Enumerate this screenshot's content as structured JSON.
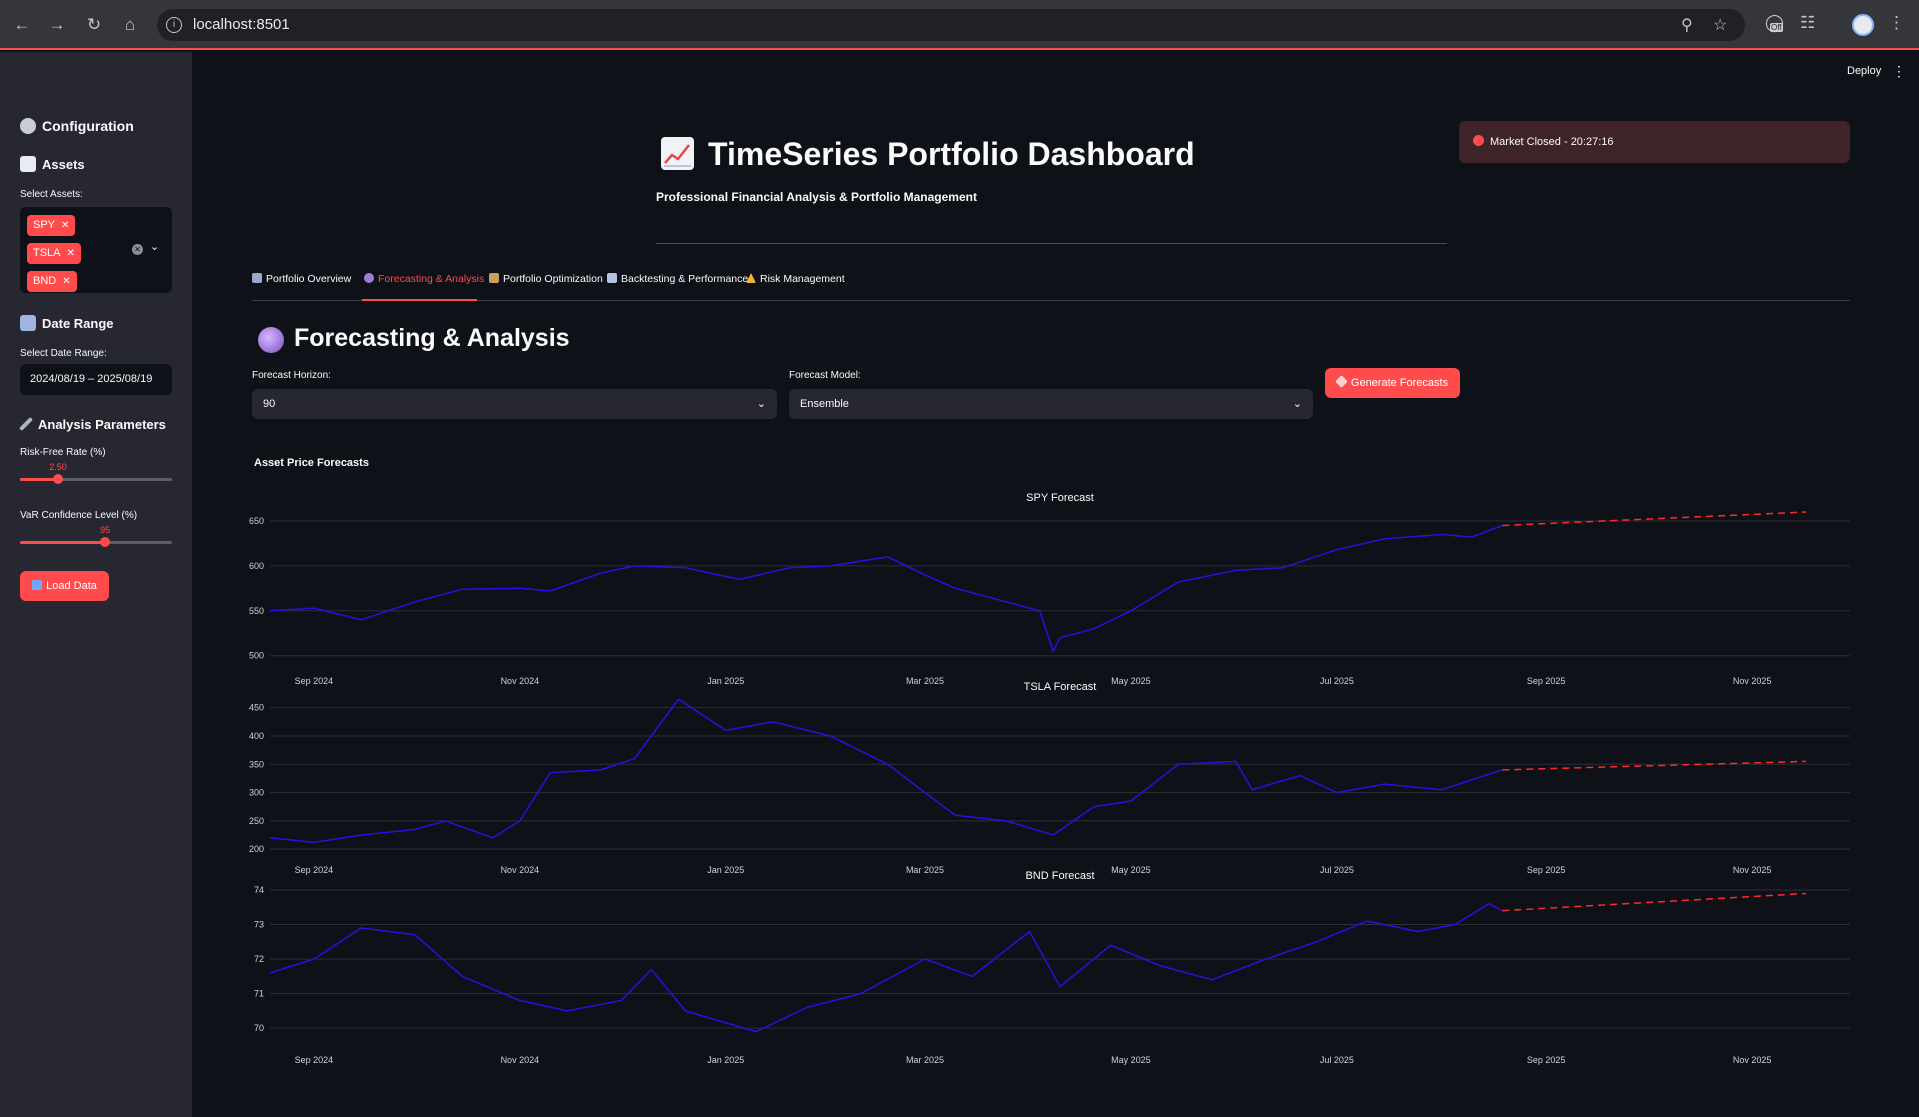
{
  "browser": {
    "url": "localhost:8501",
    "ext_badge": "Off"
  },
  "sidebar": {
    "config_title": "Configuration",
    "assets_title": "Assets",
    "select_assets_label": "Select Assets:",
    "selected_assets": [
      "SPY",
      "TSLA",
      "BND"
    ],
    "date_range_title": "Date Range",
    "date_range_label": "Select Date Range:",
    "date_range_value": "2024/08/19 – 2025/08/19",
    "analysis_title": "Analysis Parameters",
    "risk_free_label": "Risk-Free Rate (%)",
    "risk_free_value": "2.50",
    "risk_free_fraction": 0.25,
    "var_label": "VaR Confidence Level (%)",
    "var_value": "95",
    "var_fraction": 0.56,
    "load_button": "Load Data"
  },
  "header": {
    "deploy": "Deploy",
    "title": "TimeSeries Portfolio Dashboard",
    "subtitle": "Professional Financial Analysis & Portfolio Management",
    "market_status": "Market Closed - 20:27:16"
  },
  "tabs": [
    {
      "label": "Portfolio Overview",
      "icon": "bar-chart-icon",
      "active": false
    },
    {
      "label": "Forecasting & Analysis",
      "icon": "crystal-ball-icon",
      "active": true
    },
    {
      "label": "Portfolio Optimization",
      "icon": "scales-icon",
      "active": false
    },
    {
      "label": "Backtesting & Performance",
      "icon": "chart-up-icon",
      "active": false
    },
    {
      "label": "Risk Management",
      "icon": "warning-icon",
      "active": false
    }
  ],
  "forecast": {
    "section_title": "Forecasting & Analysis",
    "horizon_label": "Forecast Horizon:",
    "horizon_value": "90",
    "model_label": "Forecast Model:",
    "model_value": "Ensemble",
    "generate_button": "Generate Forecasts",
    "charts_heading": "Asset Price Forecasts"
  },
  "colors": {
    "accent": "#ff4b4b",
    "history_line": "#2a10e0",
    "forecast_line": "#ff2b2b",
    "background": "#0e1117",
    "sidebar": "#262730"
  },
  "chart_data": [
    {
      "type": "line",
      "title": "SPY Forecast",
      "x_ticks": [
        "Sep 2024",
        "Nov 2024",
        "Jan 2025",
        "Mar 2025",
        "May 2025",
        "Jul 2025",
        "Sep 2025",
        "Nov 2025"
      ],
      "y_ticks": [
        500,
        550,
        600,
        650
      ],
      "ylim": [
        493,
        660
      ],
      "series": [
        {
          "style": "solid",
          "x": [
            "2024-08-19",
            "2024-09-01",
            "2024-09-15",
            "2024-10-01",
            "2024-10-15",
            "2024-11-01",
            "2024-11-10",
            "2024-11-25",
            "2024-12-05",
            "2024-12-20",
            "2025-01-05",
            "2025-01-20",
            "2025-02-01",
            "2025-02-18",
            "2025-03-01",
            "2025-03-10",
            "2025-03-25",
            "2025-04-04",
            "2025-04-08",
            "2025-04-10",
            "2025-04-20",
            "2025-05-01",
            "2025-05-15",
            "2025-06-01",
            "2025-06-15",
            "2025-07-01",
            "2025-07-15",
            "2025-08-01",
            "2025-08-10",
            "2025-08-19"
          ],
          "y": [
            550,
            553,
            540,
            560,
            574,
            575,
            572,
            592,
            600,
            598,
            585,
            598,
            600,
            610,
            590,
            575,
            560,
            550,
            505,
            520,
            530,
            550,
            582,
            595,
            598,
            618,
            630,
            635,
            632,
            645
          ]
        },
        {
          "style": "dashed",
          "x": [
            "2025-08-19",
            "2025-11-17"
          ],
          "y": [
            645,
            660
          ]
        }
      ]
    },
    {
      "type": "line",
      "title": "TSLA Forecast",
      "x_ticks": [
        "Sep 2024",
        "Nov 2024",
        "Jan 2025",
        "Mar 2025",
        "May 2025",
        "Jul 2025",
        "Sep 2025",
        "Nov 2025"
      ],
      "y_ticks": [
        200,
        250,
        300,
        350,
        400,
        450
      ],
      "ylim": [
        195,
        460
      ],
      "series": [
        {
          "style": "solid",
          "x": [
            "2024-08-19",
            "2024-09-01",
            "2024-09-15",
            "2024-10-01",
            "2024-10-10",
            "2024-10-24",
            "2024-11-01",
            "2024-11-10",
            "2024-11-25",
            "2024-12-05",
            "2024-12-18",
            "2025-01-01",
            "2025-01-15",
            "2025-02-01",
            "2025-02-18",
            "2025-03-01",
            "2025-03-10",
            "2025-03-25",
            "2025-04-08",
            "2025-04-20",
            "2025-05-01",
            "2025-05-15",
            "2025-06-01",
            "2025-06-06",
            "2025-06-20",
            "2025-07-01",
            "2025-07-15",
            "2025-08-01",
            "2025-08-19"
          ],
          "y": [
            220,
            212,
            225,
            235,
            250,
            220,
            250,
            335,
            340,
            360,
            465,
            410,
            425,
            400,
            350,
            300,
            260,
            250,
            225,
            275,
            285,
            350,
            355,
            305,
            330,
            300,
            315,
            305,
            340
          ]
        },
        {
          "style": "dashed",
          "x": [
            "2025-08-19",
            "2025-11-17"
          ],
          "y": [
            340,
            355
          ]
        }
      ]
    },
    {
      "type": "line",
      "title": "BND Forecast",
      "x_ticks": [
        "Sep 2024",
        "Nov 2024",
        "Jan 2025",
        "Mar 2025",
        "May 2025",
        "Jul 2025",
        "Sep 2025",
        "Nov 2025"
      ],
      "y_ticks": [
        70,
        71,
        72,
        73,
        74
      ],
      "ylim": [
        69.6,
        74.0
      ],
      "series": [
        {
          "style": "solid",
          "x": [
            "2024-08-19",
            "2024-09-01",
            "2024-09-15",
            "2024-10-01",
            "2024-10-15",
            "2024-11-01",
            "2024-11-15",
            "2024-12-01",
            "2024-12-10",
            "2024-12-20",
            "2025-01-10",
            "2025-01-25",
            "2025-02-10",
            "2025-03-01",
            "2025-03-15",
            "2025-04-01",
            "2025-04-10",
            "2025-04-25",
            "2025-05-10",
            "2025-05-25",
            "2025-06-10",
            "2025-06-25",
            "2025-07-10",
            "2025-07-25",
            "2025-08-05",
            "2025-08-15",
            "2025-08-19"
          ],
          "y": [
            71.6,
            72.0,
            72.9,
            72.7,
            71.5,
            70.8,
            70.5,
            70.8,
            71.7,
            70.5,
            69.9,
            70.6,
            71.0,
            72.0,
            71.5,
            72.8,
            71.2,
            72.4,
            71.8,
            71.4,
            72.0,
            72.5,
            73.1,
            72.8,
            73.0,
            73.6,
            73.4
          ]
        },
        {
          "style": "dashed",
          "x": [
            "2025-08-19",
            "2025-11-17"
          ],
          "y": [
            73.4,
            73.9
          ]
        }
      ]
    }
  ]
}
